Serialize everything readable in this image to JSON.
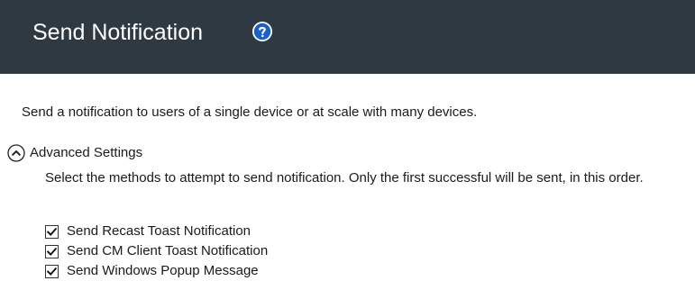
{
  "header": {
    "title": "Send Notification",
    "background": "#2e3942",
    "help_icon": "help-question-icon",
    "help_icon_color": "#1a5fc7"
  },
  "description": "Send a notification to users of a single device or at scale with many devices.",
  "advanced": {
    "toggle_icon": "chevron-up-circle-icon",
    "label": "Advanced Settings",
    "description": "Select the methods to attempt to send notification. Only the first successful will be sent, in this order.",
    "options": [
      {
        "label": "Send Recast Toast Notification",
        "checked": true
      },
      {
        "label": "Send CM Client Toast Notification",
        "checked": true
      },
      {
        "label": "Send Windows Popup Message",
        "checked": true
      }
    ]
  }
}
